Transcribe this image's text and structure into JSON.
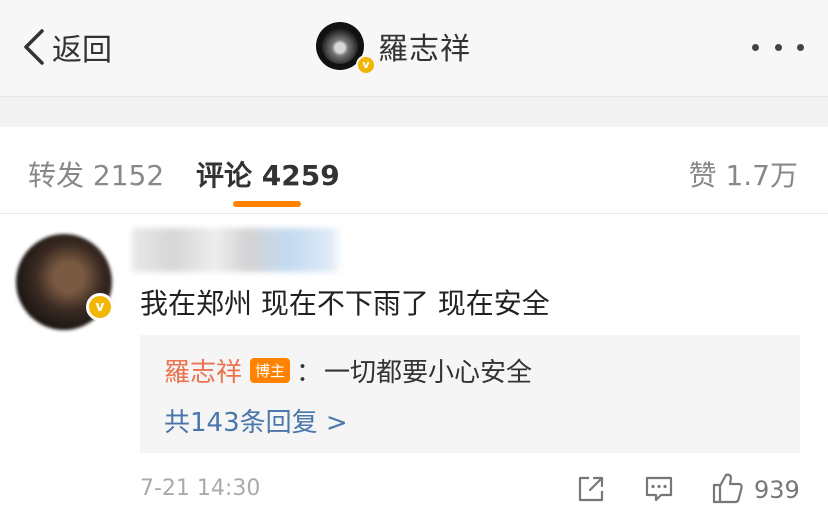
{
  "header": {
    "back_label": "返回",
    "title": "羅志祥",
    "badge_glyph": "v",
    "icons": {
      "back": "chevron-left-icon",
      "more": "more-dots-icon"
    }
  },
  "tabs": {
    "repost": "转发 2152",
    "comment": "评论 4259",
    "like": "赞 1.7万",
    "active_color": "#ff8200"
  },
  "comment": {
    "text": "我在郑州 现在不下雨了 现在安全",
    "badge_glyph": "v",
    "reply": {
      "user": "羅志祥",
      "tag": "博主",
      "colon": "：",
      "text": "一切都要小心安全",
      "more": "共143条回复 >"
    },
    "time": "7-21 14:30",
    "like_count": "939",
    "icons": {
      "share": "share-icon",
      "reply": "comment-icon",
      "like": "thumbs-up-icon"
    }
  },
  "colors": {
    "reply_user": "#eb7350",
    "link": "#4a77ab",
    "verified_badge": "#f2b600"
  }
}
